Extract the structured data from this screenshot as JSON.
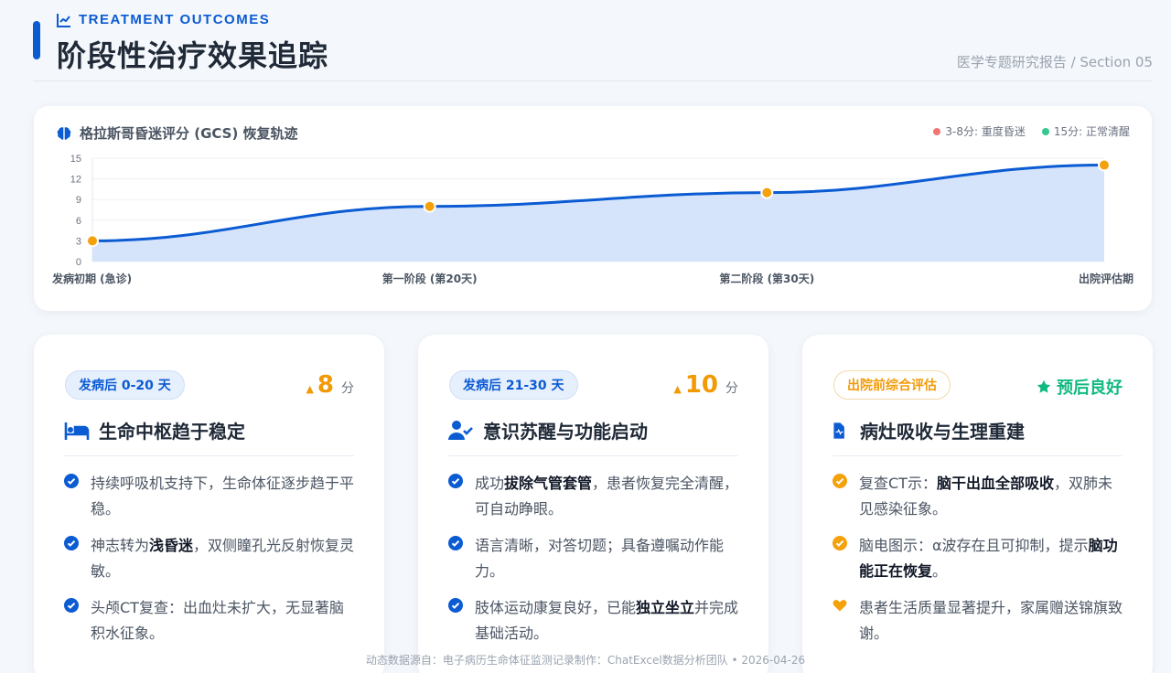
{
  "header": {
    "eyebrow": "TREATMENT OUTCOMES",
    "title": "阶段性治疗效果追踪",
    "report_tag": "医学专题研究报告 / Section 05"
  },
  "chart": {
    "title": "格拉斯哥昏迷评分 (GCS) 恢复轨迹",
    "legend": [
      {
        "label": "3-8分: 重度昏迷",
        "color": "#f07575"
      },
      {
        "label": "15分: 正常清醒",
        "color": "#34c98e"
      }
    ]
  },
  "chart_data": {
    "type": "line",
    "categories": [
      "发病初期 (急诊)",
      "第一阶段 (第20天)",
      "第二阶段 (第30天)",
      "出院评估期"
    ],
    "series": [
      {
        "values": [
          3,
          8,
          10,
          14
        ]
      }
    ],
    "ylim": [
      0,
      15
    ],
    "yticks": [
      0,
      3,
      6,
      9,
      12,
      15
    ],
    "grid": true,
    "line_color": "#0b5bd3",
    "fill_color": "#d3e3fb",
    "point_color": "#f4a10c"
  },
  "cards": [
    {
      "badge": "发病后 0-20 天",
      "delta_arrow": "▲",
      "delta_value": "8",
      "delta_unit": "分",
      "title": "生命中枢趋于稳定",
      "icon": "hospital-bed-icon",
      "items": [
        {
          "pre": "持续呼吸机支持下，生命体征逐步趋于平稳。",
          "bold": "",
          "post": ""
        },
        {
          "pre": "神志转为",
          "bold": "浅昏迷",
          "post": "，双侧瞳孔光反射恢复灵敏。"
        },
        {
          "pre": "头颅CT复查：出血灶未扩大，无显著脑积水征象。",
          "bold": "",
          "post": ""
        }
      ]
    },
    {
      "badge": "发病后 21-30 天",
      "delta_arrow": "▲",
      "delta_value": "10",
      "delta_unit": "分",
      "title": "意识苏醒与功能启动",
      "icon": "user-check-icon",
      "items": [
        {
          "pre": "成功",
          "bold": "拔除气管套管",
          "post": "，患者恢复完全清醒，可自动睁眼。"
        },
        {
          "pre": "语言清晰，对答切题；具备遵嘱动作能力。",
          "bold": "",
          "post": ""
        },
        {
          "pre": "肢体运动康复良好，已能",
          "bold": "独立坐立",
          "post": "并完成基础活动。"
        }
      ]
    },
    {
      "badge": "出院前综合评估",
      "prognosis": "预后良好",
      "title": "病灶吸收与生理重建",
      "icon": "medical-file-icon",
      "items": [
        {
          "pre": "复查CT示：",
          "bold": "脑干出血全部吸收",
          "post": "，双肺未见感染征象。"
        },
        {
          "pre": "脑电图示：α波存在且可抑制，提示",
          "bold": "脑功能正在恢复",
          "post": "。"
        },
        {
          "pre": "患者生活质量显著提升，家属赠送锦旗致谢。",
          "bold": "",
          "post": ""
        }
      ]
    }
  ],
  "footer": "动态数据源自：电子病历生命体征监测记录制作：ChatExcel数据分析团队   •   2026-04-26"
}
